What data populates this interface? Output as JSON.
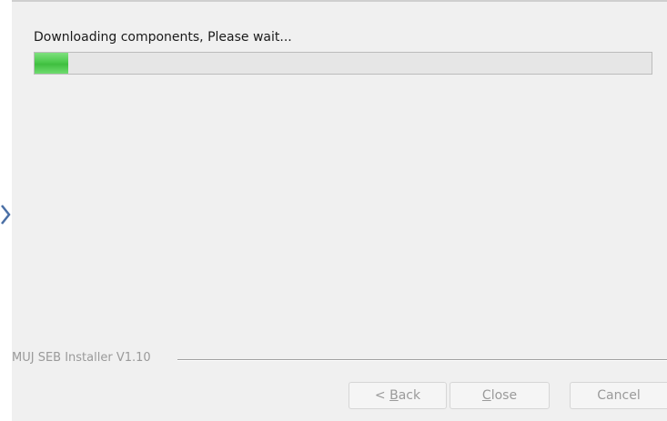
{
  "dialog": {
    "status_text": "Downloading components, Please wait...",
    "progress_fraction": 0.055,
    "progress_color": "#4cc94c",
    "installer_label": "MUJ SEB Installer V1.10"
  },
  "buttons": {
    "back": {
      "prefix": "< ",
      "accel": "B",
      "rest": "ack"
    },
    "close": {
      "prefix": "",
      "accel": "C",
      "rest": "lose"
    },
    "cancel": {
      "label": "Cancel"
    }
  },
  "decor": {
    "arrow_icon": "chevron-right-icon",
    "arrow_color": "#4a6fa5"
  }
}
